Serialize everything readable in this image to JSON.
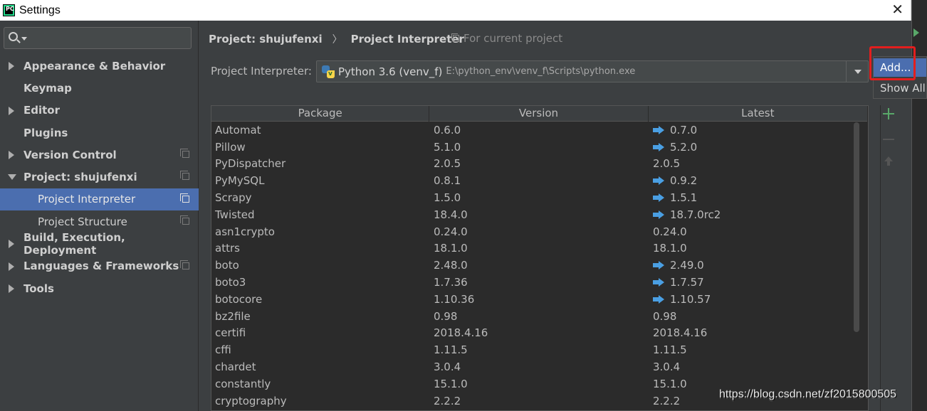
{
  "window": {
    "title": "Settings",
    "app_icon_text": "PC",
    "close_glyph": "✕"
  },
  "search": {
    "placeholder": "",
    "value": ""
  },
  "sidebar": {
    "items": [
      {
        "label": "Appearance & Behavior",
        "expandable": true,
        "expanded": false
      },
      {
        "label": "Keymap",
        "expandable": false
      },
      {
        "label": "Editor",
        "expandable": true,
        "expanded": false
      },
      {
        "label": "Plugins",
        "expandable": false
      },
      {
        "label": "Version Control",
        "expandable": true,
        "expanded": false,
        "project_scoped": true
      },
      {
        "label": "Project: shujufenxi",
        "expandable": true,
        "expanded": true,
        "project_scoped": true
      },
      {
        "label": "Project Interpreter",
        "child": true,
        "selected": true,
        "project_scoped": true
      },
      {
        "label": "Project Structure",
        "child": true,
        "project_scoped": true
      },
      {
        "label": "Build, Execution, Deployment",
        "expandable": true,
        "expanded": false
      },
      {
        "label": "Languages & Frameworks",
        "expandable": true,
        "expanded": false,
        "project_scoped": true
      },
      {
        "label": "Tools",
        "expandable": true,
        "expanded": false
      }
    ]
  },
  "breadcrumb": {
    "parent": "Project: shujufenxi",
    "separator": "〉",
    "current": "Project Interpreter",
    "scope": "For current project"
  },
  "interpreter": {
    "label": "Project Interpreter:",
    "name": "Python 3.6 (venv_f)",
    "path": "E:\\python_env\\venv_f\\Scripts\\python.exe"
  },
  "gear_menu": {
    "add_label": "Add...",
    "show_all_label": "Show All..."
  },
  "table": {
    "headers": {
      "package": "Package",
      "version": "Version",
      "latest": "Latest"
    },
    "rows": [
      {
        "package": "Automat",
        "version": "0.6.0",
        "latest": "0.7.0",
        "upgrade": true
      },
      {
        "package": "Pillow",
        "version": "5.1.0",
        "latest": "5.2.0",
        "upgrade": true
      },
      {
        "package": "PyDispatcher",
        "version": "2.0.5",
        "latest": "2.0.5",
        "upgrade": false
      },
      {
        "package": "PyMySQL",
        "version": "0.8.1",
        "latest": "0.9.2",
        "upgrade": true
      },
      {
        "package": "Scrapy",
        "version": "1.5.0",
        "latest": "1.5.1",
        "upgrade": true
      },
      {
        "package": "Twisted",
        "version": "18.4.0",
        "latest": "18.7.0rc2",
        "upgrade": true
      },
      {
        "package": "asn1crypto",
        "version": "0.24.0",
        "latest": "0.24.0",
        "upgrade": false
      },
      {
        "package": "attrs",
        "version": "18.1.0",
        "latest": "18.1.0",
        "upgrade": false
      },
      {
        "package": "boto",
        "version": "2.48.0",
        "latest": "2.49.0",
        "upgrade": true
      },
      {
        "package": "boto3",
        "version": "1.7.36",
        "latest": "1.7.57",
        "upgrade": true
      },
      {
        "package": "botocore",
        "version": "1.10.36",
        "latest": "1.10.57",
        "upgrade": true
      },
      {
        "package": "bz2file",
        "version": "0.98",
        "latest": "0.98",
        "upgrade": false
      },
      {
        "package": "certifi",
        "version": "2018.4.16",
        "latest": "2018.4.16",
        "upgrade": false
      },
      {
        "package": "cffi",
        "version": "1.11.5",
        "latest": "1.11.5",
        "upgrade": false
      },
      {
        "package": "chardet",
        "version": "3.0.4",
        "latest": "3.0.4",
        "upgrade": false
      },
      {
        "package": "constantly",
        "version": "15.1.0",
        "latest": "15.1.0",
        "upgrade": false
      },
      {
        "package": "cryptography",
        "version": "2.2.2",
        "latest": "2.2.2",
        "upgrade": false
      }
    ]
  },
  "watermark": "https://blog.csdn.net/zf2015800505",
  "colors": {
    "background": "#3c3f41",
    "table_background": "#2b2b2b",
    "selection": "#4b6eaf",
    "upgrade_arrow": "#4a9fe3",
    "add_icon": "#59a869",
    "highlight": "#e31e1e"
  },
  "icons": {
    "search": "search-icon",
    "expand": "chevron-right-icon",
    "collapse": "chevron-down-icon",
    "project_scope": "copy-icon",
    "python": "python-icon",
    "upgrade": "arrow-right-icon",
    "add": "plus-icon",
    "remove": "minus-icon",
    "upgrade_package": "arrow-up-icon"
  }
}
